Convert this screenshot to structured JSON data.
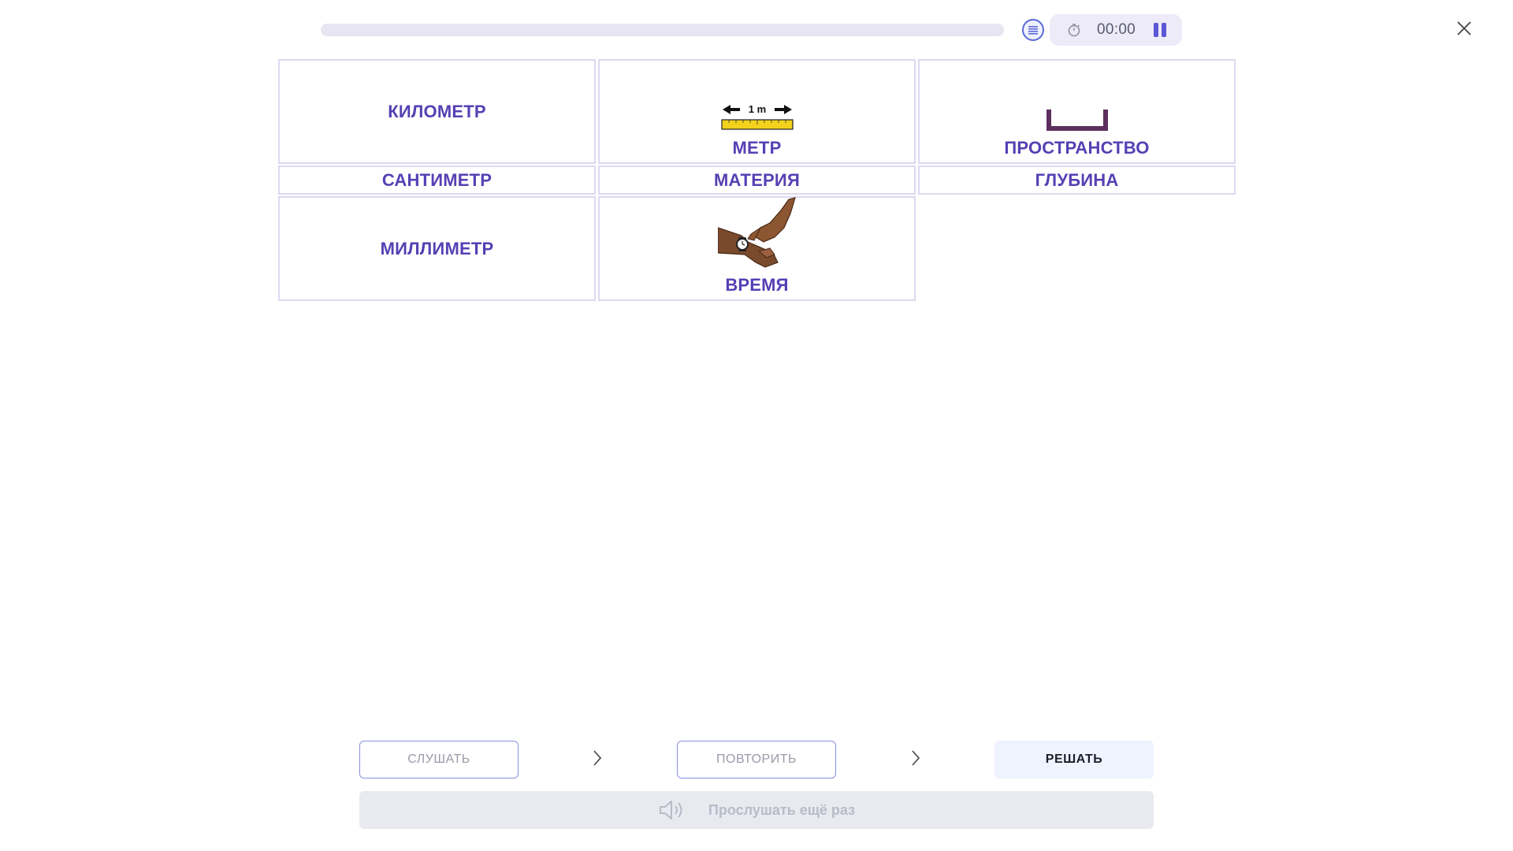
{
  "header": {
    "progress_fraction": 0.0,
    "timer": "00:00"
  },
  "grid": {
    "row1": [
      {
        "label": "КИЛОМЕТР",
        "picture": "none"
      },
      {
        "label": "МЕТР",
        "picture": "ruler-1m-picture"
      },
      {
        "label": "ПРОСТРАНСТВО",
        "picture": "space-bracket-picture"
      }
    ],
    "row2": [
      {
        "label": "САНТИМЕТР"
      },
      {
        "label": "МАТЕРИЯ"
      },
      {
        "label": "ГЛУБИНА"
      }
    ],
    "row3": [
      {
        "label": "МИЛЛИМЕТР",
        "picture": "none"
      },
      {
        "label": "ВРЕМЯ",
        "picture": "wristwatch-picture"
      }
    ]
  },
  "ruler_label": "1 m",
  "controls": {
    "listen": "СЛУШАТЬ",
    "repeat": "ПОВТОРИТЬ",
    "solve": "РЕШАТЬ",
    "replay": "Прослушать ещё раз"
  },
  "colors": {
    "accent": "#5640b4",
    "cell_border": "#dcd9f0",
    "timer_bg": "#ecebf7",
    "solve_bg": "#eef3fd",
    "replay_bg": "#e8eaf0"
  },
  "icons": [
    "list-icon",
    "stopwatch-icon",
    "pause-icon",
    "close-icon",
    "chevron-right-icon",
    "speaker-icon"
  ]
}
